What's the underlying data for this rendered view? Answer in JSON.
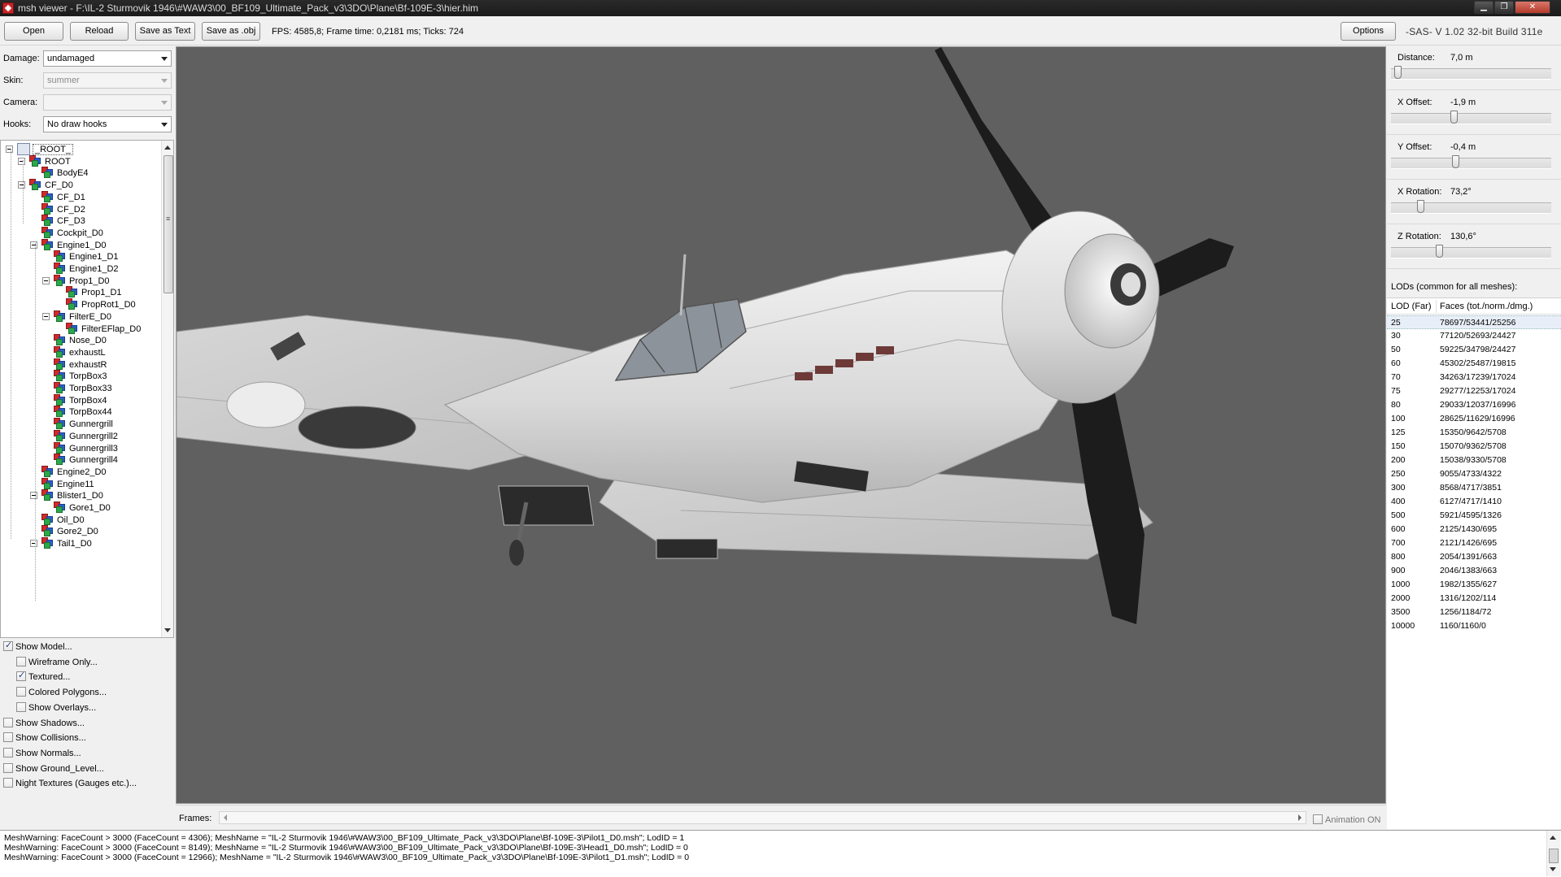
{
  "window": {
    "title": "msh viewer - F:\\IL-2 Sturmovik 1946\\#WAW3\\00_BF109_Ultimate_Pack_v3\\3DO\\Plane\\Bf-109E-3\\hier.him"
  },
  "toolbar": {
    "open_label": "Open",
    "reload_label": "Reload",
    "save_text_label": "Save as Text",
    "save_obj_label": "Save as .obj",
    "fps_text": "FPS: 4585,8; Frame time: 0,2181 ms; Ticks: 724",
    "options_label": "Options",
    "version_text": "-SAS- V 1.02  32-bit  Build 311e"
  },
  "controls": {
    "damage": {
      "label": "Damage:",
      "value": "undamaged"
    },
    "skin": {
      "label": "Skin:",
      "value": "summer"
    },
    "camera": {
      "label": "Camera:",
      "value": ""
    },
    "hooks": {
      "label": "Hooks:",
      "value": "No draw hooks"
    }
  },
  "tree": [
    {
      "label": "_ROOT_",
      "depth": 0,
      "expanded": true,
      "root": true
    },
    {
      "label": "ROOT",
      "depth": 1,
      "expanded": true
    },
    {
      "label": "BodyE4",
      "depth": 2
    },
    {
      "label": "CF_D0",
      "depth": 1,
      "expanded": true
    },
    {
      "label": "CF_D1",
      "depth": 2
    },
    {
      "label": "CF_D2",
      "depth": 2
    },
    {
      "label": "CF_D3",
      "depth": 2
    },
    {
      "label": "Cockpit_D0",
      "depth": 2
    },
    {
      "label": "Engine1_D0",
      "depth": 2,
      "expanded": true
    },
    {
      "label": "Engine1_D1",
      "depth": 3
    },
    {
      "label": "Engine1_D2",
      "depth": 3
    },
    {
      "label": "Prop1_D0",
      "depth": 3,
      "expanded": true
    },
    {
      "label": "Prop1_D1",
      "depth": 4
    },
    {
      "label": "PropRot1_D0",
      "depth": 4
    },
    {
      "label": "FilterE_D0",
      "depth": 3,
      "expanded": true
    },
    {
      "label": "FilterEFlap_D0",
      "depth": 4
    },
    {
      "label": "Nose_D0",
      "depth": 3
    },
    {
      "label": "exhaustL",
      "depth": 3
    },
    {
      "label": "exhaustR",
      "depth": 3
    },
    {
      "label": "TorpBox3",
      "depth": 3
    },
    {
      "label": "TorpBox33",
      "depth": 3
    },
    {
      "label": "TorpBox4",
      "depth": 3
    },
    {
      "label": "TorpBox44",
      "depth": 3
    },
    {
      "label": "Gunnergrill",
      "depth": 3
    },
    {
      "label": "Gunnergrill2",
      "depth": 3
    },
    {
      "label": "Gunnergrill3",
      "depth": 3
    },
    {
      "label": "Gunnergrill4",
      "depth": 3
    },
    {
      "label": "Engine2_D0",
      "depth": 2
    },
    {
      "label": "Engine11",
      "depth": 2
    },
    {
      "label": "Blister1_D0",
      "depth": 2,
      "expanded": true
    },
    {
      "label": "Gore1_D0",
      "depth": 3
    },
    {
      "label": "Oil_D0",
      "depth": 2
    },
    {
      "label": "Gore2_D0",
      "depth": 2
    },
    {
      "label": "Tail1_D0",
      "depth": 2,
      "expanded": true
    }
  ],
  "checkboxes": [
    {
      "label": "Show Model...",
      "checked": true,
      "indent": 0
    },
    {
      "label": "Wireframe Only...",
      "checked": false,
      "indent": 1
    },
    {
      "label": "Textured...",
      "checked": true,
      "indent": 1
    },
    {
      "label": "Colored Polygons...",
      "checked": false,
      "indent": 1
    },
    {
      "label": "Show Overlays...",
      "checked": false,
      "indent": 1
    },
    {
      "label": "Show Shadows...",
      "checked": false,
      "indent": 0
    },
    {
      "label": "Show Collisions...",
      "checked": false,
      "indent": 0
    },
    {
      "label": "Show Normals...",
      "checked": false,
      "indent": 0
    },
    {
      "label": "Show Ground_Level...",
      "checked": false,
      "indent": 0
    },
    {
      "label": "Night Textures (Gauges etc.)...",
      "checked": false,
      "indent": 0
    }
  ],
  "frames": {
    "label": "Frames:",
    "animation_label": "Animation ON",
    "animation_on": false
  },
  "sliders": [
    {
      "label": "Distance:",
      "value": "7,0 m",
      "level": 0.02
    },
    {
      "label": "X Offset:",
      "value": "-1,9 m",
      "level": 0.39
    },
    {
      "label": "Y Offset:",
      "value": "-0,4 m",
      "level": 0.4
    },
    {
      "label": "X Rotation:",
      "value": "73,2°",
      "level": 0.17
    },
    {
      "label": "Z Rotation:",
      "value": "130,6°",
      "level": 0.29
    }
  ],
  "lods": {
    "title": "LODs (common for all meshes):",
    "col_lod": "LOD (Far)",
    "col_faces": "Faces (tot./norm./dmg.)",
    "rows": [
      {
        "lod": "25",
        "faces": "78697/53441/25256",
        "selected": true
      },
      {
        "lod": "30",
        "faces": "77120/52693/24427"
      },
      {
        "lod": "50",
        "faces": "59225/34798/24427"
      },
      {
        "lod": "60",
        "faces": "45302/25487/19815"
      },
      {
        "lod": "70",
        "faces": "34263/17239/17024"
      },
      {
        "lod": "75",
        "faces": "29277/12253/17024"
      },
      {
        "lod": "80",
        "faces": "29033/12037/16996"
      },
      {
        "lod": "100",
        "faces": "28625/11629/16996"
      },
      {
        "lod": "125",
        "faces": "15350/9642/5708"
      },
      {
        "lod": "150",
        "faces": "15070/9362/5708"
      },
      {
        "lod": "200",
        "faces": "15038/9330/5708"
      },
      {
        "lod": "250",
        "faces": "9055/4733/4322"
      },
      {
        "lod": "300",
        "faces": "8568/4717/3851"
      },
      {
        "lod": "400",
        "faces": "6127/4717/1410"
      },
      {
        "lod": "500",
        "faces": "5921/4595/1326"
      },
      {
        "lod": "600",
        "faces": "2125/1430/695"
      },
      {
        "lod": "700",
        "faces": "2121/1426/695"
      },
      {
        "lod": "800",
        "faces": "2054/1391/663"
      },
      {
        "lod": "900",
        "faces": "2046/1383/663"
      },
      {
        "lod": "1000",
        "faces": "1982/1355/627"
      },
      {
        "lod": "2000",
        "faces": "1316/1202/114"
      },
      {
        "lod": "3500",
        "faces": "1256/1184/72"
      },
      {
        "lod": "10000",
        "faces": "1160/1160/0"
      }
    ]
  },
  "log": [
    "MeshWarning: FaceCount > 3000 (FaceCount = 4306); MeshName = \"IL-2 Sturmovik 1946\\#WAW3\\00_BF109_Ultimate_Pack_v3\\3DO\\Plane\\Bf-109E-3\\Pilot1_D0.msh\"; LodID = 1",
    "MeshWarning: FaceCount > 3000 (FaceCount = 8149); MeshName = \"IL-2 Sturmovik 1946\\#WAW3\\00_BF109_Ultimate_Pack_v3\\3DO\\Plane\\Bf-109E-3\\Head1_D0.msh\"; LodID = 0",
    "MeshWarning: FaceCount > 3000 (FaceCount = 12966); MeshName = \"IL-2 Sturmovik 1946\\#WAW3\\00_BF109_Ultimate_Pack_v3\\3DO\\Plane\\Bf-109E-3\\Pilot1_D1.msh\"; LodID = 0"
  ],
  "colors": {
    "viewport_bg": "#606060",
    "aircraft_body": "#e6e6e6",
    "propeller": "#1c1c1c",
    "selection": "#e8eef8"
  }
}
